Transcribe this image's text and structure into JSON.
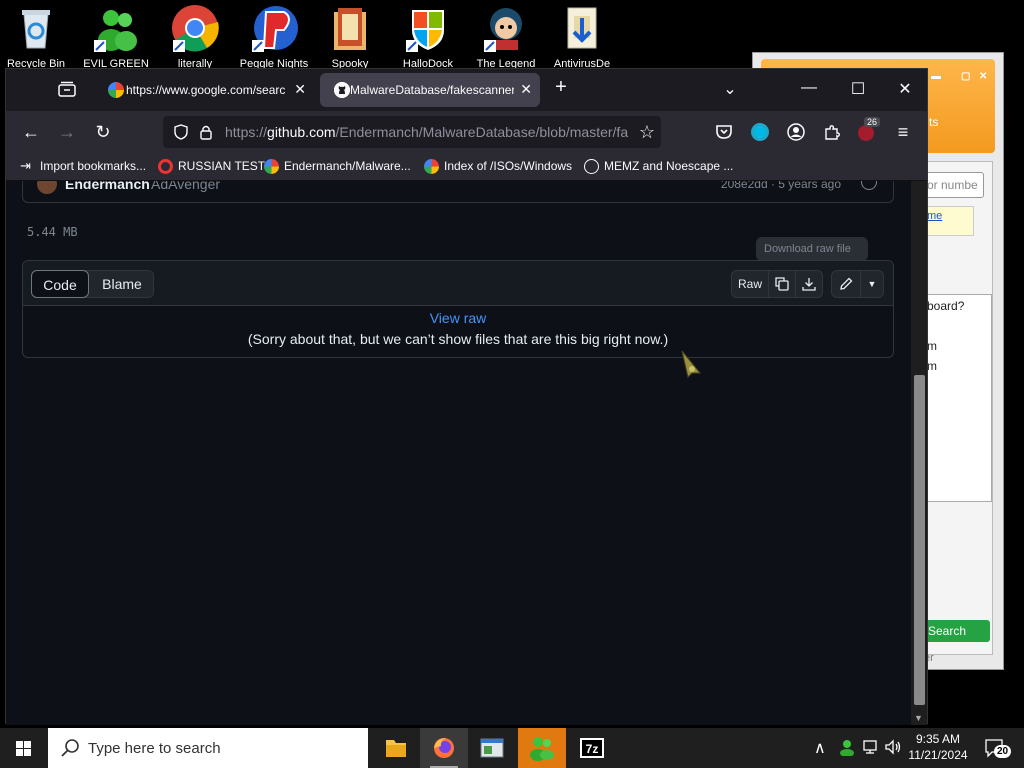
{
  "desktop": {
    "icons": [
      {
        "label": "Recycle Bin"
      },
      {
        "label": "EVIL GREEN"
      },
      {
        "label": "literally"
      },
      {
        "label": "Peggle Nights"
      },
      {
        "label": "Spooky"
      },
      {
        "label": "HalloDock"
      },
      {
        "label": "The Legend"
      },
      {
        "label": "AntivirusDe"
      }
    ]
  },
  "bg_window": {
    "orange_text_1": "ts",
    "search_placeholder": "or numbe",
    "yellow_link": "me",
    "list_text_1": "board?",
    "list_text_2": "m",
    "list_text_3": "m",
    "search_button": "Search",
    "footer_text": "er"
  },
  "browser": {
    "tabs": [
      {
        "title": "https://www.google.com/searc"
      },
      {
        "title": "MalwareDatabase/fakescanners"
      }
    ],
    "new_tab": "+",
    "url": {
      "scheme": "https://",
      "host": "github.com",
      "path": "/Endermanch/MalwareDatabase/blob/master/fa"
    },
    "notification_badge": "26",
    "bookmarks": [
      {
        "label": "Import bookmarks..."
      },
      {
        "label": "RUSSIAN TEST"
      },
      {
        "label": "Endermanch/Malware..."
      },
      {
        "label": "Index of /ISOs/Windows"
      },
      {
        "label": "MEMZ and Noescape ..."
      }
    ]
  },
  "page": {
    "commit": {
      "author": "Endermanch",
      "message": "AdAvenger",
      "meta": "208e2dd · 5 years ago"
    },
    "file_size": "5.44 MB",
    "tooltip": "Download raw file",
    "tabs": {
      "code": "Code",
      "blame": "Blame"
    },
    "raw_button": "Raw",
    "view_raw": "View raw",
    "sorry": "(Sorry about that, but we can’t show files that are this big right now.)"
  },
  "taskbar": {
    "search_placeholder": "Type here to search",
    "time": "9:35 AM",
    "date": "11/21/2024",
    "notifications": "20"
  }
}
